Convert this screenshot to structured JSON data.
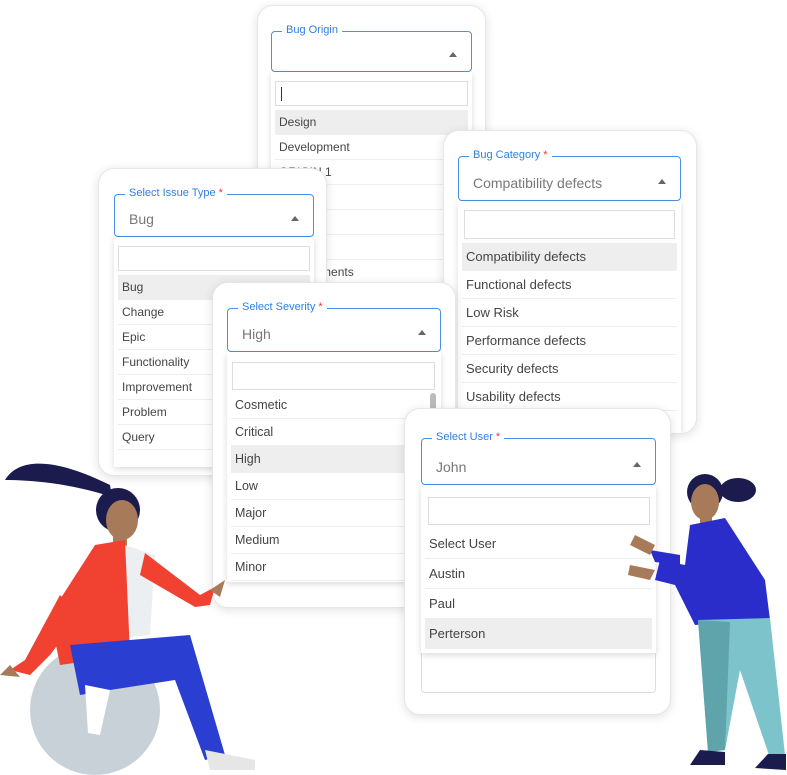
{
  "bug_origin": {
    "label": "Bug Origin",
    "value": "",
    "items": [
      "Design",
      "Development",
      "ORIGIN 1",
      "",
      "",
      "",
      "Requirements"
    ],
    "selected": 0
  },
  "issue_type": {
    "label": "Select Issue Type",
    "value": "Bug",
    "required": "*",
    "items": [
      "Bug",
      "Change",
      "Epic",
      "Functionality",
      "Improvement",
      "Problem",
      "Query"
    ],
    "selected": 0
  },
  "bug_category": {
    "label": "Bug Category",
    "value": "Compatibility defects",
    "required": "*",
    "items": [
      "Compatibility defects",
      "Functional defects",
      "Low Risk",
      "Performance defects",
      "Security defects",
      "Usability defects"
    ],
    "selected": 0
  },
  "severity": {
    "label": "Select Severity",
    "value": "High",
    "required": "*",
    "items": [
      "Cosmetic",
      "Critical",
      "High",
      "Low",
      "Major",
      "Medium",
      "Minor"
    ],
    "selected": 2
  },
  "user": {
    "label": "Select User",
    "value": "John",
    "required": "*",
    "items": [
      "Select User",
      "Austin",
      "Paul",
      "Perterson"
    ],
    "selected": 3
  },
  "colors": {
    "accent": "#2f7fe0",
    "required": "#e53935",
    "selected_row": "#eeeeee"
  }
}
